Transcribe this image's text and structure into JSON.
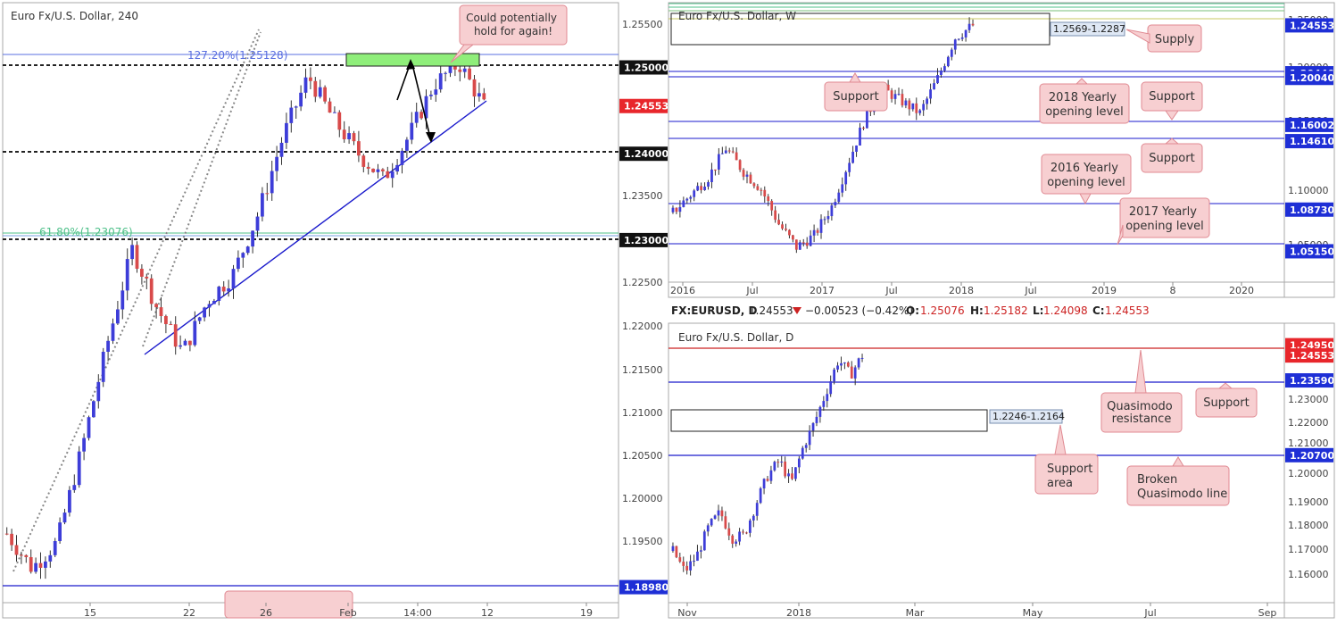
{
  "colors": {
    "up": "#3d3dd8",
    "down": "#d84a4a",
    "wick": "#333333",
    "blue_line": "#1a1acc",
    "red_line": "#cc2222",
    "callout_fill": "#f7cfd1",
    "callout_stroke": "#e08a92",
    "green_zone": "#8fee7a",
    "fib_blue": "#5a6fe0",
    "fib_green": "#4fc08a"
  },
  "chart_data": [
    {
      "type": "candlestick",
      "title": "Euro Fx/U.S. Dollar, 240",
      "ylim": [
        1.188,
        1.2575
      ],
      "x_ticks": [
        "15",
        "22",
        "26",
        "Feb",
        "14:00",
        "12",
        "19"
      ],
      "y_ticks": [
        "1.25500",
        "1.25000",
        "1.24500",
        "1.24000",
        "1.23500",
        "1.23000",
        "1.22500",
        "1.22000",
        "1.21500",
        "1.21000",
        "1.20500",
        "1.20000",
        "1.19500",
        "1.18980"
      ],
      "price_labels": [
        {
          "text": "1.25000",
          "value": 1.25,
          "style": "dark"
        },
        {
          "text": "1.24553",
          "value": 1.24553,
          "style": "red"
        },
        {
          "text": "1.24000",
          "value": 1.24,
          "style": "dark"
        },
        {
          "text": "1.23000",
          "value": 1.23,
          "style": "dark"
        },
        {
          "text": "1.18980",
          "value": 1.1898,
          "style": "blue"
        }
      ],
      "annotations": [
        {
          "text": "127.20%(1.25128)",
          "value": 1.25128
        },
        {
          "text": "61.80%(1.23076)",
          "value": 1.23076
        },
        {
          "text": "Could potentially hold for again!"
        }
      ]
    },
    {
      "type": "candlestick",
      "title": "Euro Fx/U.S. Dollar, W",
      "ylim": [
        1.025,
        1.265
      ],
      "x_ticks": [
        "2016",
        "Jul",
        "2017",
        "Jul",
        "2018",
        "Jul",
        "2019",
        "8",
        "2020"
      ],
      "y_ticks": [
        "1.25000",
        "1.20000",
        "1.15000",
        "1.10000",
        "1.05000"
      ],
      "price_labels": [
        {
          "text": "1.24553",
          "value": 1.24553,
          "style": "blue"
        },
        {
          "text": "1.20440",
          "value": 1.2044,
          "style": "blue"
        },
        {
          "text": "1.20040",
          "value": 1.2004,
          "style": "blue"
        },
        {
          "text": "1.16002",
          "value": 1.16002,
          "style": "blue"
        },
        {
          "text": "1.14610",
          "value": 1.1461,
          "style": "blue"
        },
        {
          "text": "1.08730",
          "value": 1.0873,
          "style": "blue"
        },
        {
          "text": "1.05150",
          "value": 1.0515,
          "style": "blue"
        }
      ],
      "annotations": [
        {
          "text": "1.2569-1.2287"
        },
        {
          "text": "Supply"
        },
        {
          "text": "Support"
        },
        {
          "text": "2018 Yearly opening level"
        },
        {
          "text": "Support"
        },
        {
          "text": "Support"
        },
        {
          "text": "2016 Yearly opening level"
        },
        {
          "text": "2017 Yearly opening level"
        }
      ]
    },
    {
      "type": "candlestick",
      "title": "Euro Fx/U.S. Dollar, D",
      "ylim": [
        1.15,
        1.258
      ],
      "x_ticks": [
        "Nov",
        "2018",
        "Mar",
        "May",
        "Jul",
        "Sep"
      ],
      "y_ticks": [
        "1.23000",
        "1.22000",
        "1.21000",
        "1.20000",
        "1.19000",
        "1.18000",
        "1.17000",
        "1.16000"
      ],
      "price_labels": [
        {
          "text": "1.24950",
          "value": 1.2495,
          "style": "red"
        },
        {
          "text": "1.24553",
          "value": 1.24553,
          "style": "red"
        },
        {
          "text": "1.23590",
          "value": 1.2359,
          "style": "blue"
        },
        {
          "text": "1.20700",
          "value": 1.207,
          "style": "blue"
        }
      ],
      "annotations": [
        {
          "text": "1.2246-1.2164"
        },
        {
          "text": "Quasimodo resistance"
        },
        {
          "text": "Support"
        },
        {
          "text": "Support area"
        },
        {
          "text": "Broken Quasimodo line"
        }
      ]
    }
  ],
  "quote_bar": {
    "symbol": "FX:EURUSD, D",
    "last": "1.24553",
    "change": "−0.00523 (−0.42%)",
    "o_label": "O:",
    "o": "1.25076",
    "h_label": "H:",
    "h": "1.25182",
    "l_label": "L:",
    "l": "1.24098",
    "c_label": "C:",
    "c": "1.24553"
  }
}
